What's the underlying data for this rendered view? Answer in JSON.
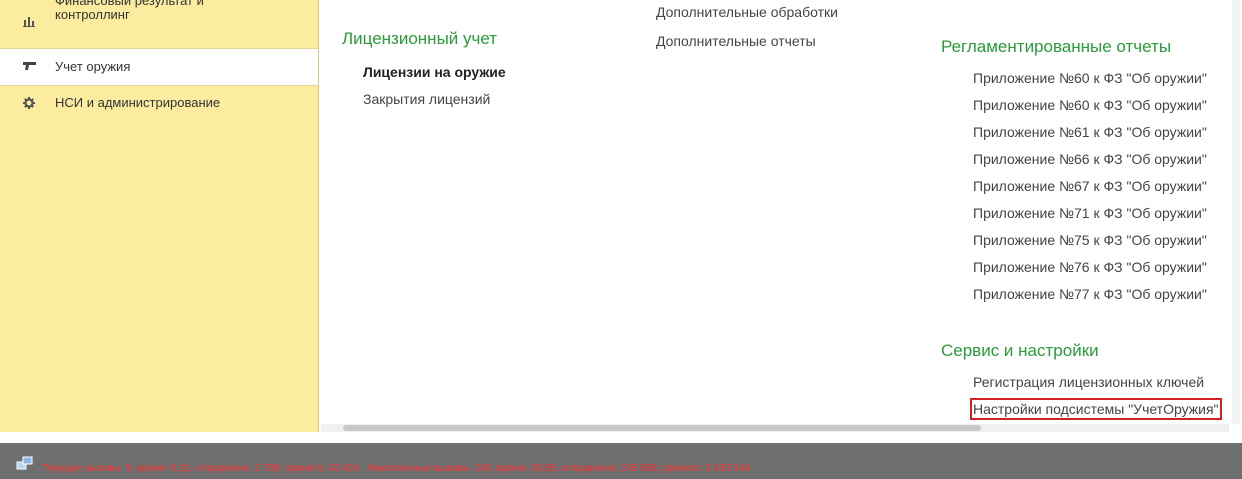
{
  "sidebar": {
    "items": [
      {
        "label": "Финансовый результат и контроллинг",
        "icon": "bar-chart-icon"
      },
      {
        "label": "Учет оружия",
        "icon": "gun-icon"
      },
      {
        "label": "НСИ и администрирование",
        "icon": "gear-icon"
      }
    ]
  },
  "main": {
    "license_section": {
      "title": "Лицензионный учет",
      "links": [
        "Лицензии на оружие",
        "Закрытия лицензий"
      ]
    },
    "additional": {
      "links": [
        "Дополнительные обработки",
        "Дополнительные отчеты"
      ]
    },
    "reg_reports": {
      "title": "Регламентированные отчеты",
      "links": [
        "Приложение №60 к ФЗ \"Об оружии\"",
        "Приложение №60 к ФЗ \"Об оружии\"",
        "Приложение №61 к ФЗ \"Об оружии\"",
        "Приложение №66 к ФЗ \"Об оружии\"",
        "Приложение №67 к ФЗ \"Об оружии\"",
        "Приложение №71 к ФЗ \"Об оружии\"",
        "Приложение №75 к ФЗ \"Об оружии\"",
        "Приложение №76 к ФЗ \"Об оружии\"",
        "Приложение №77 к ФЗ \"Об оружии\""
      ]
    },
    "service": {
      "title": "Сервис и настройки",
      "links": [
        "Регистрация лицензионных ключей",
        "Настройки подсистемы \"УчетОружия\""
      ]
    }
  },
  "statusbar": {
    "text": "Текущие вызовы: 5; время: 0,11; отправлено: 1 786; принято: 42 424 . Накопленные вызовы: 245; время: 20,85; отправлено: 245 083; принято: 3 620 544"
  }
}
